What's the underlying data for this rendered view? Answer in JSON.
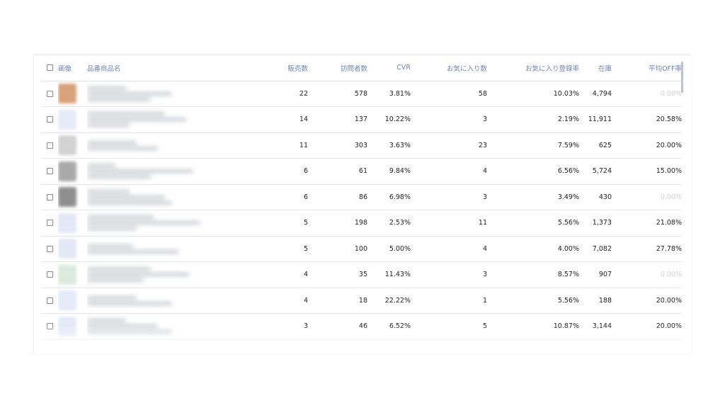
{
  "table": {
    "columns": [
      "画像",
      "品番商品名",
      "販売数",
      "訪問者数",
      "CVR",
      "お気に入り数",
      "お気に入り登録率",
      "在庫",
      "平均OFF率"
    ],
    "rows": [
      {
        "sales": "22",
        "visitors": "578",
        "cvr": "3.81%",
        "favorites": "58",
        "fav_rate": "10.03%",
        "stock": "4,794",
        "avg_off": "0.00%",
        "thumb_color": "#d8a27a",
        "off_muted": true
      },
      {
        "sales": "14",
        "visitors": "137",
        "cvr": "10.22%",
        "favorites": "3",
        "fav_rate": "2.19%",
        "stock": "11,911",
        "avg_off": "20.58%",
        "thumb_color": "#e6ebf8",
        "off_muted": false
      },
      {
        "sales": "11",
        "visitors": "303",
        "cvr": "3.63%",
        "favorites": "23",
        "fav_rate": "7.59%",
        "stock": "625",
        "avg_off": "20.00%",
        "thumb_color": "#d2d2d2",
        "off_muted": false
      },
      {
        "sales": "6",
        "visitors": "61",
        "cvr": "9.84%",
        "favorites": "4",
        "fav_rate": "6.56%",
        "stock": "5,724",
        "avg_off": "15.00%",
        "thumb_color": "#a9a9a9",
        "off_muted": false
      },
      {
        "sales": "6",
        "visitors": "86",
        "cvr": "6.98%",
        "favorites": "3",
        "fav_rate": "3.49%",
        "stock": "430",
        "avg_off": "0.00%",
        "thumb_color": "#8f8f8f",
        "off_muted": true
      },
      {
        "sales": "5",
        "visitors": "198",
        "cvr": "2.53%",
        "favorites": "11",
        "fav_rate": "5.56%",
        "stock": "1,373",
        "avg_off": "21.08%",
        "thumb_color": "#e3e8f7",
        "off_muted": false
      },
      {
        "sales": "5",
        "visitors": "100",
        "cvr": "5.00%",
        "favorites": "4",
        "fav_rate": "4.00%",
        "stock": "7,082",
        "avg_off": "27.78%",
        "thumb_color": "#e3e8f7",
        "off_muted": false
      },
      {
        "sales": "4",
        "visitors": "35",
        "cvr": "11.43%",
        "favorites": "3",
        "fav_rate": "8.57%",
        "stock": "907",
        "avg_off": "0.00%",
        "thumb_color": "#dbe9df",
        "off_muted": true
      },
      {
        "sales": "4",
        "visitors": "18",
        "cvr": "22.22%",
        "favorites": "1",
        "fav_rate": "5.56%",
        "stock": "188",
        "avg_off": "20.00%",
        "thumb_color": "#e5e9f8",
        "off_muted": false
      },
      {
        "sales": "3",
        "visitors": "46",
        "cvr": "6.52%",
        "favorites": "5",
        "fav_rate": "10.87%",
        "stock": "3,144",
        "avg_off": "20.00%",
        "thumb_color": "#e5e9f8",
        "off_muted": false
      }
    ]
  },
  "colors": {
    "header_text": "#6d86b3",
    "muted_text": "#d2d2d2",
    "scrollbar": "#b9c3d3"
  }
}
